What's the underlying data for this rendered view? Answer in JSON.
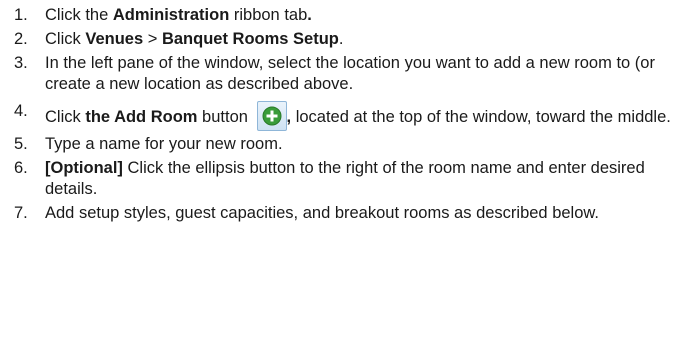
{
  "steps": [
    {
      "number": "1.",
      "segments": [
        {
          "text": "Click the ",
          "bold": false
        },
        {
          "text": "Administration",
          "bold": true
        },
        {
          "text": " ribbon tab",
          "bold": false
        },
        {
          "text": ".",
          "bold": true
        }
      ]
    },
    {
      "number": "2.",
      "segments": [
        {
          "text": "Click ",
          "bold": false
        },
        {
          "text": "Venues",
          "bold": true
        },
        {
          "text": " > ",
          "bold": false
        },
        {
          "text": "Banquet Rooms Setup",
          "bold": true
        },
        {
          "text": ".",
          "bold": false
        }
      ]
    },
    {
      "number": "3.",
      "segments": [
        {
          "text": "In the left pane of the window, select the location you want to add a new room to (or create a new location as described above.",
          "bold": false
        }
      ]
    },
    {
      "number": "4.",
      "segments": [
        {
          "text": "Click ",
          "bold": false
        },
        {
          "text": "the Add Room",
          "bold": true
        },
        {
          "text": " button ",
          "bold": false
        },
        {
          "text": ",",
          "bold": true
        },
        {
          "text": " located at the top of the window, toward the middle.",
          "bold": false
        }
      ],
      "icon": "add-room-plus-icon"
    },
    {
      "number": "5.",
      "segments": [
        {
          "text": "Type a name for your new room.",
          "bold": false
        }
      ]
    },
    {
      "number": "6.",
      "segments": [
        {
          "text": "[Optional]",
          "bold": true
        },
        {
          "text": " Click the ellipsis button to the right of the room name and enter desired details.",
          "bold": false
        }
      ]
    },
    {
      "number": "7.",
      "segments": [
        {
          "text": "Add setup styles, guest capacities, and breakout rooms as described below.",
          "bold": false
        }
      ]
    }
  ],
  "colors": {
    "text": "#1a1a1a",
    "icon_green": "#3a9c3a",
    "icon_frame": "#8fb6d8"
  }
}
